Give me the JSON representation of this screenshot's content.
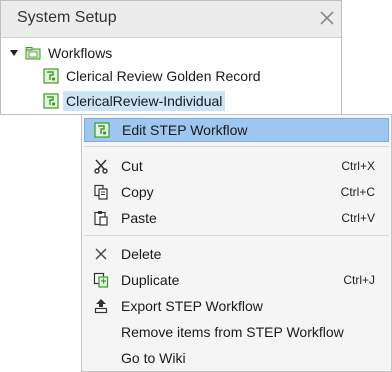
{
  "panel": {
    "title": "System Setup",
    "tree": {
      "root": {
        "label": "Workflows",
        "icon": "folder-icon"
      },
      "items": [
        {
          "label": "Clerical Review Golden Record",
          "icon": "workflow-icon"
        },
        {
          "label": "ClericalReview-Individual",
          "icon": "workflow-icon",
          "selected": true
        }
      ]
    }
  },
  "context_menu": {
    "items": [
      {
        "label": "Edit STEP Workflow",
        "icon": "workflow-edit-icon",
        "shortcut": "",
        "highlighted": true
      },
      {
        "label": "Cut",
        "icon": "scissors-icon",
        "shortcut": "Ctrl+X"
      },
      {
        "label": "Copy",
        "icon": "copy-icon",
        "shortcut": "Ctrl+C"
      },
      {
        "label": "Paste",
        "icon": "paste-icon",
        "shortcut": "Ctrl+V"
      },
      {
        "label": "Delete",
        "icon": "delete-x-icon",
        "shortcut": ""
      },
      {
        "label": "Duplicate",
        "icon": "duplicate-icon",
        "shortcut": "Ctrl+J"
      },
      {
        "label": "Export STEP Workflow",
        "icon": "export-icon",
        "shortcut": ""
      },
      {
        "label": "Remove items from STEP Workflow",
        "icon": "",
        "shortcut": ""
      },
      {
        "label": "Go to Wiki",
        "icon": "",
        "shortcut": ""
      }
    ]
  },
  "colors": {
    "highlight": "#9ec6ef",
    "selection": "#cce4f7",
    "workflow_icon": "#3f9a2a"
  }
}
